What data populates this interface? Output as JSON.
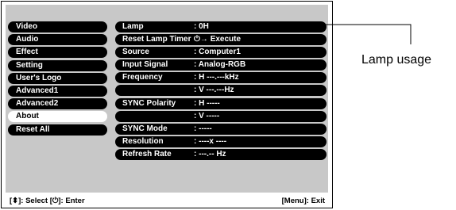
{
  "menu": {
    "items": [
      {
        "label": "Video"
      },
      {
        "label": "Audio"
      },
      {
        "label": "Effect"
      },
      {
        "label": "Setting"
      },
      {
        "label": "User's Logo"
      },
      {
        "label": "Advanced1"
      },
      {
        "label": "Advanced2"
      },
      {
        "label": "About",
        "selected": true
      },
      {
        "label": "Reset All"
      }
    ]
  },
  "panel": {
    "rows": [
      {
        "label": "Lamp",
        "value": ":        0H"
      },
      {
        "label": "Reset Lamp Timer",
        "value": "⏻→ Execute"
      },
      {
        "label": "Source",
        "value": ": Computer1"
      },
      {
        "label": "Input Signal",
        "value": ": Analog-RGB"
      },
      {
        "label": "Frequency",
        "value": ": H ---.---kHz"
      },
      {
        "label": "",
        "value": ": V ---.---Hz"
      },
      {
        "label": "SYNC Polarity",
        "value": ": H -----"
      },
      {
        "label": "",
        "value": ": V -----"
      },
      {
        "label": "SYNC Mode",
        "value": ": -----"
      },
      {
        "label": "Resolution",
        "value": ": ----x   ----"
      },
      {
        "label": "Refresh Rate",
        "value": ": ---.-- Hz"
      }
    ]
  },
  "footer": {
    "left": "[⬍]: Select  [⏻]: Enter",
    "right": "[Menu]: Exit"
  },
  "callout": {
    "text": "Lamp usage"
  }
}
